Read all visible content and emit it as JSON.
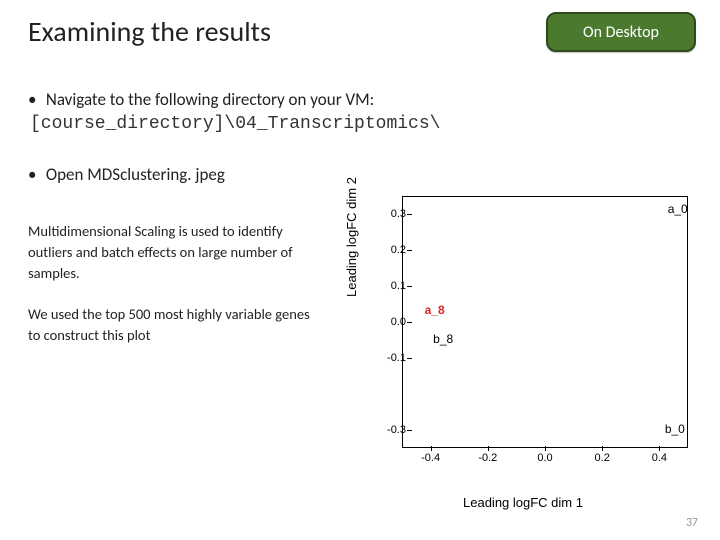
{
  "title": "Examining the results",
  "badge": "On Desktop",
  "body": {
    "nav_line": "Navigate to the following directory on your VM:",
    "path": "[course_directory]\\04_Transcriptomics\\",
    "open_line": "Open MDSclustering. jpeg",
    "mds_desc": "Multidimensional Scaling is used to identify outliers and batch effects on large number of samples.",
    "mds_note": "We used the top 500 most highly variable genes to construct this plot"
  },
  "page_number": "37",
  "chart_data": {
    "type": "scatter",
    "xlabel": "Leading logFC dim 1",
    "ylabel": "Leading logFC dim 2",
    "xlim": [
      -0.5,
      0.5
    ],
    "ylim": [
      -0.35,
      0.35
    ],
    "x_ticks": [
      -0.4,
      -0.2,
      0.0,
      0.2,
      0.4
    ],
    "y_ticks": [
      -0.3,
      -0.1,
      0.0,
      0.1,
      0.2,
      0.3
    ],
    "points": [
      {
        "label": "a_0",
        "x": 0.45,
        "y": 0.31,
        "highlight": false
      },
      {
        "label": "a_8",
        "x": -0.4,
        "y": 0.03,
        "highlight": true
      },
      {
        "label": "b_8",
        "x": -0.37,
        "y": -0.05,
        "highlight": false
      },
      {
        "label": "b_0",
        "x": 0.44,
        "y": -0.3,
        "highlight": false
      }
    ]
  }
}
